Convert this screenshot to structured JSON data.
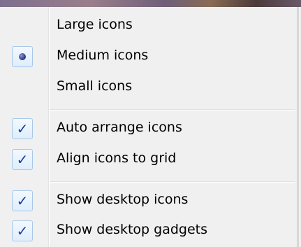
{
  "menu": {
    "groups": [
      {
        "items": [
          {
            "label": "Large icons",
            "state": "none"
          },
          {
            "label": "Medium icons",
            "state": "radio"
          },
          {
            "label": "Small icons",
            "state": "none"
          }
        ]
      },
      {
        "items": [
          {
            "label": "Auto arrange icons",
            "state": "check"
          },
          {
            "label": "Align icons to grid",
            "state": "check"
          }
        ]
      },
      {
        "items": [
          {
            "label": "Show desktop icons",
            "state": "check"
          },
          {
            "label": "Show desktop gadgets",
            "state": "check"
          }
        ]
      }
    ]
  },
  "icons": {
    "check": "checkmark-icon",
    "radio": "radio-bullet-icon"
  },
  "colors": {
    "menu_background": "#f0f0f0",
    "check_color": "#1a3f9e",
    "mark_border": "#a8c8e8"
  }
}
